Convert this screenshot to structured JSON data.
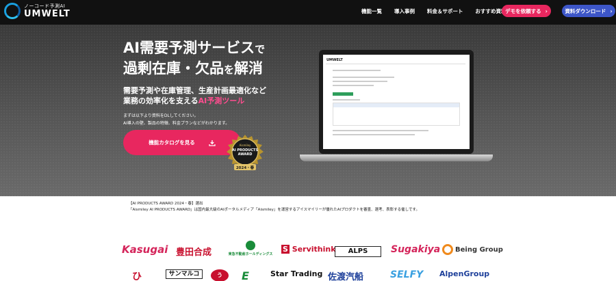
{
  "header": {
    "logo_sub": "ノーコード予測AI",
    "logo_name": "UMWELT",
    "nav": [
      "機能一覧",
      "導入事例",
      "料金＆サポート",
      "おすすめ資料"
    ],
    "demo_button": "デモを依頼する",
    "download_button": "資料ダウンロード"
  },
  "hero": {
    "title1_main": "AI需要予測サービス",
    "title1_small": "で",
    "title2_main": "過剰在庫・欠品",
    "title2_small": "を",
    "title2_end": "解消",
    "sub1": "需要予測や在庫管理、生産計画最適化など",
    "sub2_main": "業務の効率化を支える",
    "sub2_accent": "AI予測ツール",
    "note1": "まずは以下より資料をDLしてください。",
    "note2": "AI導入の壁、製品の特徴、料金プランなどがわかります。",
    "catalog_button": "機能カタログを見る",
    "screen_logo": "UMWELT"
  },
  "award": {
    "label_top": "Aismiley",
    "label_main": "AI PRODUCTS",
    "label_main2": "AWARD",
    "label_year": "2024・春",
    "line1": "【AI PRODUCTS AWARD 2024・春】選出",
    "line2": "「Aismiley AI PRODUCTS AWARD」は国内最大級のAIポータルメディア「Aismiley」を運営するアイスマイリーが優れたAIプロダクトを審査、選考、表彰する催しです。"
  },
  "clients": {
    "row1": [
      "Kasugai",
      "豊田合成",
      "東急不動産ホールディングス",
      "Servithink",
      "ALPS",
      "Sugakiya",
      "Being Group"
    ],
    "row2": [
      "ひ",
      "サンマルコ",
      "う",
      "E",
      "Star Trading",
      "佐渡汽船",
      "SELFY",
      "AlpenGroup"
    ]
  },
  "colors": {
    "accent_pink": "#e8275f",
    "accent_blue": "#3d56c8",
    "header_bg": "#111111"
  }
}
